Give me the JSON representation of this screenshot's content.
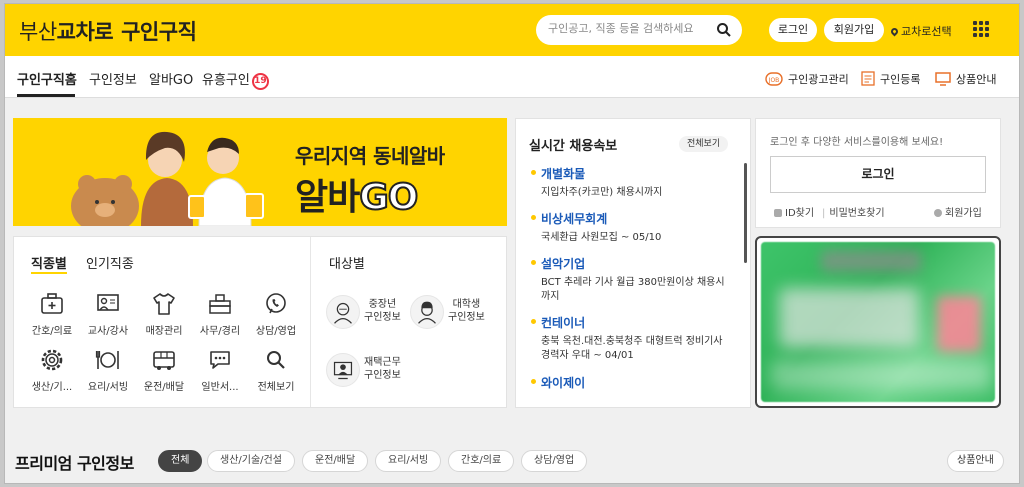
{
  "header": {
    "logo_part1": "부산",
    "logo_part2": "교차로",
    "logo_part3": "구인구직",
    "search_placeholder": "구인공고, 직종 등을 검색하세요",
    "login_label": "로그인",
    "join_label": "회원가입",
    "region_label": "교차로선택",
    "brand_color": "#ffd400"
  },
  "nav": {
    "tabs": [
      {
        "label": "구인구직홈"
      },
      {
        "label": "구인정보"
      },
      {
        "label": "알바GO"
      },
      {
        "label": "유흥구인"
      }
    ],
    "adult_badge": "19",
    "right": [
      {
        "label": "구인광고관리",
        "icon": "job-ad-manage-icon"
      },
      {
        "label": "구인등록",
        "icon": "job-register-icon"
      },
      {
        "label": "상품안내",
        "icon": "monitor-icon"
      }
    ]
  },
  "banner": {
    "line1": "우리지역 동네알바",
    "line2_a": "알바",
    "line2_b": "GO"
  },
  "jobs": {
    "tab_active": "직종별",
    "tab_other": "인기직종",
    "items": [
      {
        "label": "간호/의료",
        "icon": "medical-kit-icon"
      },
      {
        "label": "교사/강사",
        "icon": "teacher-board-icon"
      },
      {
        "label": "매장관리",
        "icon": "shirt-icon"
      },
      {
        "label": "사무/경리",
        "icon": "office-desk-icon"
      },
      {
        "label": "상담/영업",
        "icon": "phone-chat-icon"
      },
      {
        "label": "생산/기...",
        "icon": "gear-icon"
      },
      {
        "label": "요리/서빙",
        "icon": "cutlery-icon"
      },
      {
        "label": "운전/배달",
        "icon": "bus-icon"
      },
      {
        "label": "일반서...",
        "icon": "speech-bubble-icon"
      },
      {
        "label": "전체보기",
        "icon": "search-icon"
      }
    ],
    "target_title": "대상별",
    "targets": [
      {
        "line1": "중장년",
        "line2": "구인정보",
        "icon": "senior-avatar-icon"
      },
      {
        "line1": "대학생",
        "line2": "구인정보",
        "icon": "student-avatar-icon"
      },
      {
        "line1": "재택근무",
        "line2": "구인정보",
        "icon": "remote-work-icon"
      }
    ]
  },
  "realtime": {
    "title": "실시간 채용속보",
    "view_all": "전체보기",
    "items": [
      {
        "company": "개별화물",
        "desc": "지입차주(카코만) 채용시까지"
      },
      {
        "company": "비상세무회계",
        "desc": "국세환급 사원모집 ~ 05/10"
      },
      {
        "company": "설악기업",
        "desc": "BCT 추레라 기사 월급 380만원이상 채용시까지"
      },
      {
        "company": "컨테이너",
        "desc": "충북 옥천.대전.충북청주 대형트럭 정비기사 경력자 우대 ~ 04/01"
      },
      {
        "company": "와이제이",
        "desc": ""
      }
    ]
  },
  "login_box": {
    "message": "로그인 후 다양한 서비스를이용해 보세요!",
    "button": "로그인",
    "find_id": "ID찾기",
    "find_pw": "비밀번호찾기",
    "join": "회원가입"
  },
  "premium": {
    "title": "프리미엄 구인정보",
    "chips": [
      "전체",
      "생산/기술/건설",
      "운전/배달",
      "요리/서빙",
      "간호/의료",
      "상담/영업"
    ],
    "product_info": "상품안내"
  }
}
